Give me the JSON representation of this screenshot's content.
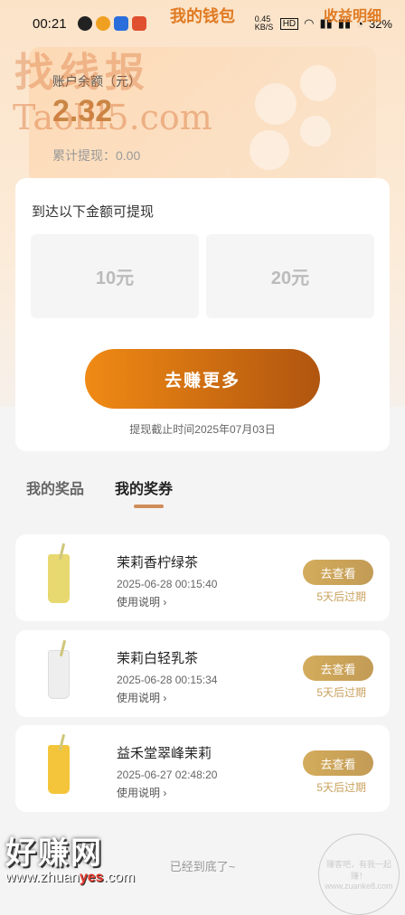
{
  "status": {
    "time": "00:21",
    "speed": "0.45 KB/S",
    "battery": "32%"
  },
  "nav": {
    "title": "我的钱包",
    "right": "收益明细"
  },
  "balance": {
    "label": "账户余额（元）",
    "value": "2.32",
    "withdrawn": "累计提现：0.00"
  },
  "watermark": {
    "line1": "找线报",
    "line2": "Taolll5.com",
    "bottom": "好赚网",
    "bottom_url_a": "www.zhuan",
    "bottom_url_b": "yes",
    "bottom_url_c": ".com",
    "stamp": "赚客吧，有我一起赚！ www.zuanke8.com"
  },
  "withdraw": {
    "title": "到达以下金额可提现",
    "options": [
      "10元",
      "20元"
    ],
    "button": "去赚更多",
    "deadline": "提现截止时间2025年07月03日"
  },
  "tabs": [
    "我的奖品",
    "我的奖券"
  ],
  "vouchers": [
    {
      "name": "茉莉香柠绿茶",
      "time": "2025-06-28 00:15:40",
      "usage": "使用说明 ›",
      "button": "去查看",
      "expire": "5天后过期",
      "color": "#e8d870"
    },
    {
      "name": "茉莉白轻乳茶",
      "time": "2025-06-28 00:15:34",
      "usage": "使用说明 ›",
      "button": "去查看",
      "expire": "5天后过期",
      "color": "#eeeeee"
    },
    {
      "name": "益禾堂翠峰茉莉",
      "time": "2025-06-27 02:48:20",
      "usage": "使用说明 ›",
      "button": "去查看",
      "expire": "5天后过期",
      "color": "#f4c53a"
    }
  ],
  "footer": "已经到底了~"
}
